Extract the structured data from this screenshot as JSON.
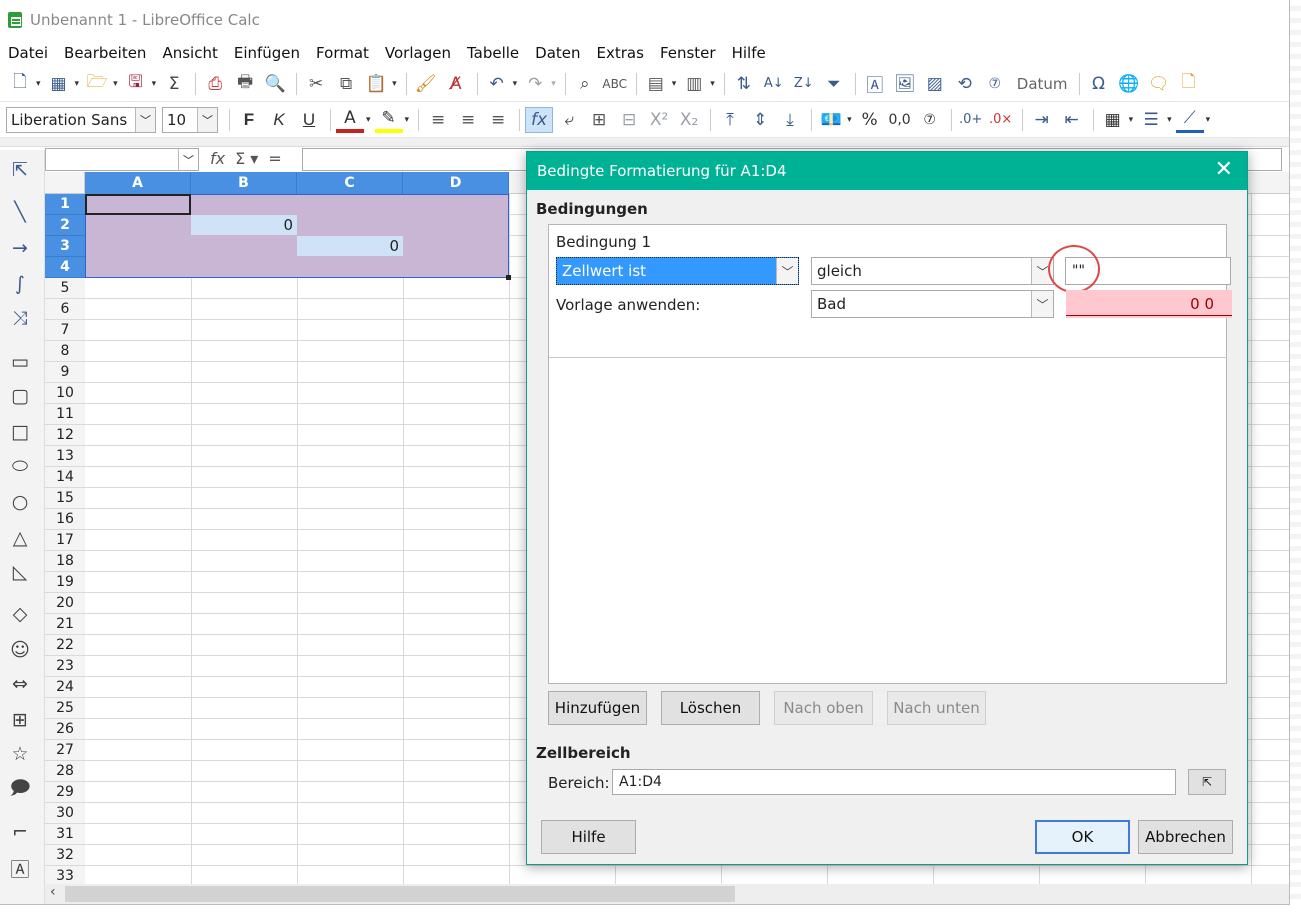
{
  "window": {
    "title": "Unbenannt 1 - LibreOffice Calc"
  },
  "menu": [
    "Datei",
    "Bearbeiten",
    "Ansicht",
    "Einfügen",
    "Format",
    "Vorlagen",
    "Tabelle",
    "Daten",
    "Extras",
    "Fenster",
    "Hilfe"
  ],
  "toolbar": {
    "datum_label": "Datum",
    "font_name": "Liberation Sans",
    "font_size": "10"
  },
  "formula_bar": {
    "name_box": "",
    "content": ""
  },
  "sheet": {
    "columns": [
      "A",
      "B",
      "C",
      "D"
    ],
    "rows": [
      "1",
      "2",
      "3",
      "4",
      "5",
      "6",
      "7",
      "8",
      "9",
      "10",
      "11",
      "12",
      "13",
      "14",
      "15",
      "16",
      "17",
      "18",
      "19",
      "20",
      "21",
      "22",
      "23",
      "24",
      "25",
      "26",
      "27",
      "28",
      "29",
      "30",
      "31",
      "32",
      "33"
    ],
    "cell_b2": "0",
    "cell_c3": "0"
  },
  "dialog": {
    "title": "Bedingte Formatierung für A1:D4",
    "section_conditions": "Bedingungen",
    "condition_label": "Bedingung 1",
    "condition_type": "Zellwert ist",
    "operator": "gleich",
    "value": "\"\"",
    "apply_style_label": "Vorlage anwenden:",
    "style": "Bad",
    "preview_text": "0 0",
    "buttons": {
      "add": "Hinzufügen",
      "delete": "Löschen",
      "up": "Nach oben",
      "down": "Nach unten",
      "help": "Hilfe",
      "ok": "OK",
      "cancel": "Abbrechen"
    },
    "section_range": "Zellbereich",
    "range_label": "Bereich:",
    "range_value": "A1:D4"
  }
}
